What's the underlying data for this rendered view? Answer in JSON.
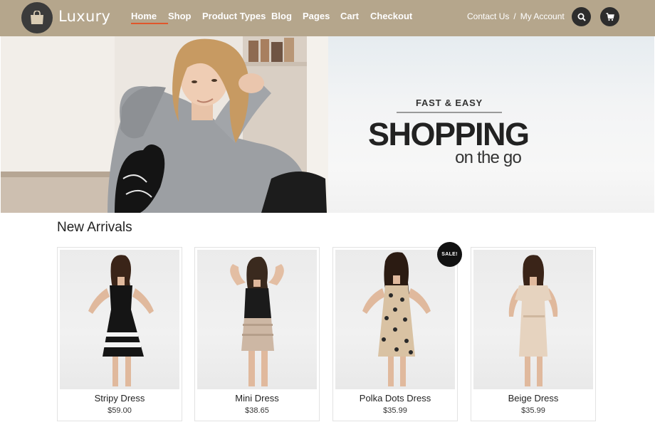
{
  "brand": {
    "name": "Luxury",
    "logo_icon": "shopping-bag-icon"
  },
  "nav": {
    "items": [
      {
        "label": "Home",
        "active": true
      },
      {
        "label": "Shop"
      },
      {
        "label": "Product Types"
      },
      {
        "label": "Blog"
      },
      {
        "label": "Pages"
      },
      {
        "label": "Cart"
      },
      {
        "label": "Checkout"
      }
    ]
  },
  "top_links": {
    "contact": "Contact Us",
    "separator": "/",
    "account": "My Account"
  },
  "header_icons": {
    "search": "search-icon",
    "cart": "cart-icon"
  },
  "hero": {
    "kicker": "FAST & EASY",
    "title": "SHOPPING",
    "subtitle": "on the go"
  },
  "new_arrivals": {
    "title": "New Arrivals",
    "products": [
      {
        "name": "Stripy Dress",
        "price": "$59.00"
      },
      {
        "name": "Mini Dress",
        "price": "$38.65"
      },
      {
        "name": "Polka Dots Dress",
        "price": "$35.99",
        "badge": "SALE!"
      },
      {
        "name": "Beige Dress",
        "price": "$35.99"
      }
    ]
  },
  "colors": {
    "header_bg": "#b5a68c",
    "active_underline": "#e0562b",
    "dark_button": "#2d2d2d"
  }
}
